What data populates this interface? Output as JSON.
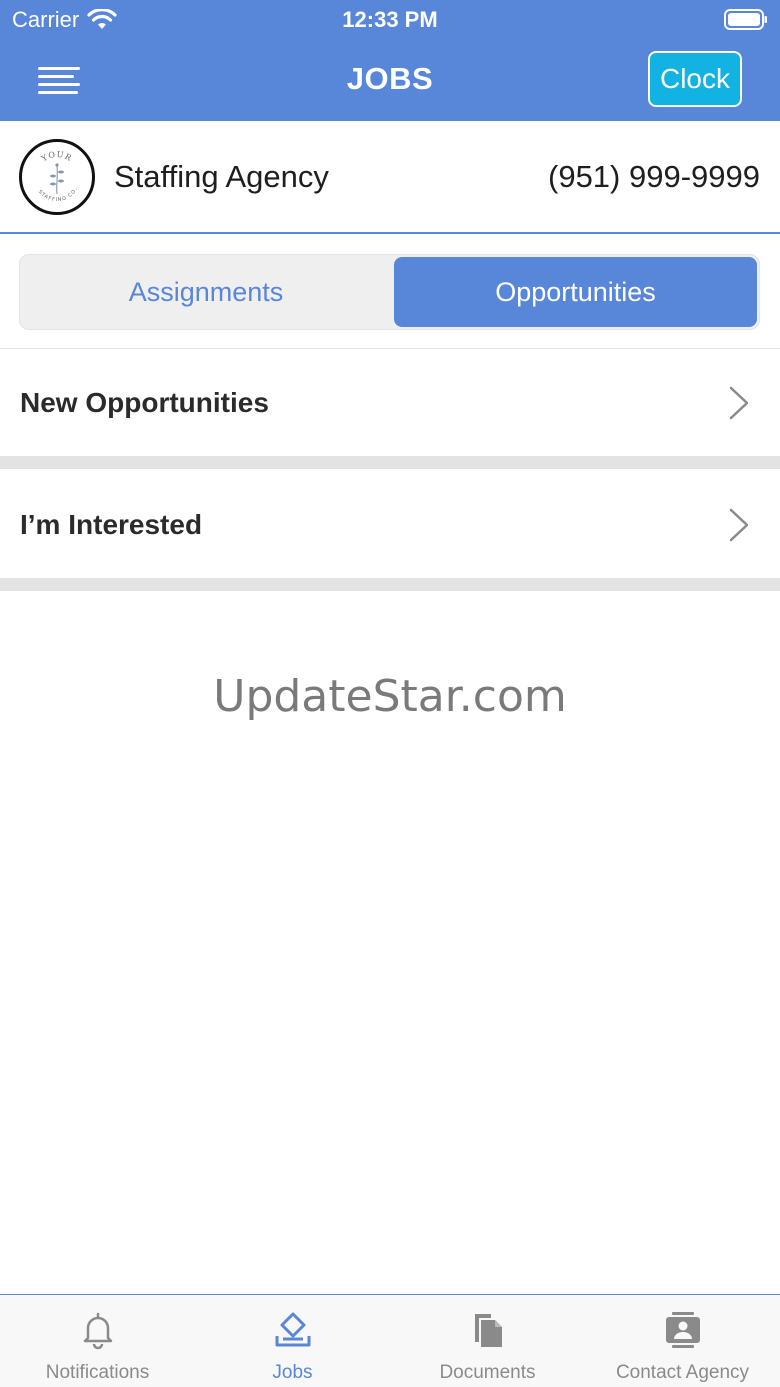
{
  "status_bar": {
    "carrier": "Carrier",
    "time": "12:33 PM"
  },
  "nav": {
    "title": "JOBS",
    "clock_label": "Clock"
  },
  "agency": {
    "name": "Staffing Agency",
    "phone": "(951) 999-9999",
    "logo_text_top": "YOUR",
    "logo_text_bottom": "STAFFING CO."
  },
  "segments": [
    {
      "label": "Assignments",
      "selected": false
    },
    {
      "label": "Opportunities",
      "selected": true
    }
  ],
  "rows": [
    {
      "label": "New Opportunities"
    },
    {
      "label": "I’m Interested"
    }
  ],
  "watermark": "UpdateStar.com",
  "tabs": [
    {
      "label": "Notifications",
      "icon": "bell-icon",
      "active": false
    },
    {
      "label": "Jobs",
      "icon": "jobs-icon",
      "active": true
    },
    {
      "label": "Documents",
      "icon": "documents-icon",
      "active": false
    },
    {
      "label": "Contact Agency",
      "icon": "contact-card-icon",
      "active": false
    }
  ],
  "colors": {
    "primary": "#5886d9",
    "clock_button": "#12b3e2",
    "inactive_tab": "#8a8a8a"
  }
}
